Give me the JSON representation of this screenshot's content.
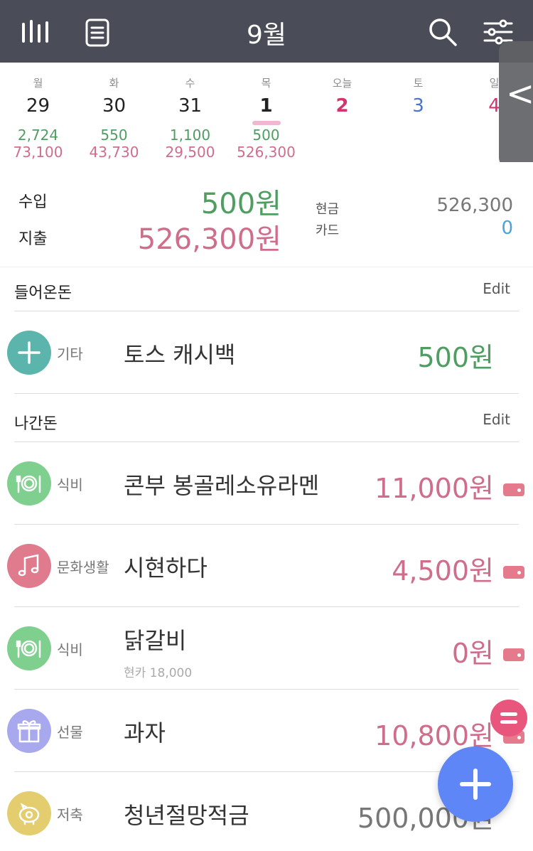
{
  "header": {
    "title": "9월"
  },
  "week": [
    {
      "name": "월",
      "num": "29",
      "income": "2,724",
      "expense": "73,100",
      "color": "#222222"
    },
    {
      "name": "화",
      "num": "30",
      "income": "550",
      "expense": "43,730",
      "color": "#222222"
    },
    {
      "name": "수",
      "num": "31",
      "income": "1,100",
      "expense": "29,500",
      "color": "#222222"
    },
    {
      "name": "목",
      "num": "1",
      "income": "500",
      "expense": "526,300",
      "color": "#111111",
      "selected": true
    },
    {
      "name": "오늘",
      "num": "2",
      "income": "",
      "expense": "",
      "color": "#d6336c"
    },
    {
      "name": "토",
      "num": "3",
      "income": "",
      "expense": "",
      "color": "#4a74c9"
    },
    {
      "name": "일",
      "num": "4",
      "income": "",
      "expense": "",
      "color": "#d6336c"
    }
  ],
  "side_tab": {
    "glyph": "<"
  },
  "summary": {
    "income_label": "수입",
    "income_value": "500원",
    "expense_label": "지출",
    "expense_value": "526,300원",
    "cash_label": "현금",
    "cash_value": "526,300",
    "card_label": "카드",
    "card_value": "0"
  },
  "income_section": {
    "title": "들어온돈",
    "edit": "Edit",
    "rows": [
      {
        "category": "기타",
        "icon": "plus-icon",
        "icon_bg": "#5bb5ad",
        "memo": "토스 캐시백",
        "amount": "500원",
        "amount_color": "#4e9e62"
      }
    ]
  },
  "expense_section": {
    "title": "나간돈",
    "edit": "Edit",
    "rows": [
      {
        "category": "식비",
        "icon": "plate-icon",
        "icon_bg": "#7fd08e",
        "memo": "콘부 봉골레소유라멘",
        "amount": "11,000원",
        "amount_color": "#cf6d8b"
      },
      {
        "category": "문화생활",
        "icon": "music-note-icon",
        "icon_bg": "#e07b8d",
        "memo": "시현하다",
        "amount": "4,500원",
        "amount_color": "#cf6d8b"
      },
      {
        "category": "식비",
        "icon": "plate-icon",
        "icon_bg": "#7fd08e",
        "memo": "닭갈비",
        "sub": "현카 18,000",
        "amount": "0원",
        "amount_color": "#cf6d8b"
      },
      {
        "category": "선물",
        "icon": "gift-icon",
        "icon_bg": "#a7a8ee",
        "memo": "과자",
        "amount": "10,800원",
        "amount_color": "#cf6d8b"
      },
      {
        "category": "저축",
        "icon": "piggy-bank-icon",
        "icon_bg": "#e3cd6f",
        "memo": "청년절망적금",
        "amount": "500,000원",
        "amount_color": "#777777"
      }
    ]
  },
  "colors": {
    "topbar": "#4a4d57",
    "income": "#4e9e62",
    "expense": "#cf6d8b",
    "fab": "#5f86f7",
    "mini_fab": "#e8557d"
  }
}
